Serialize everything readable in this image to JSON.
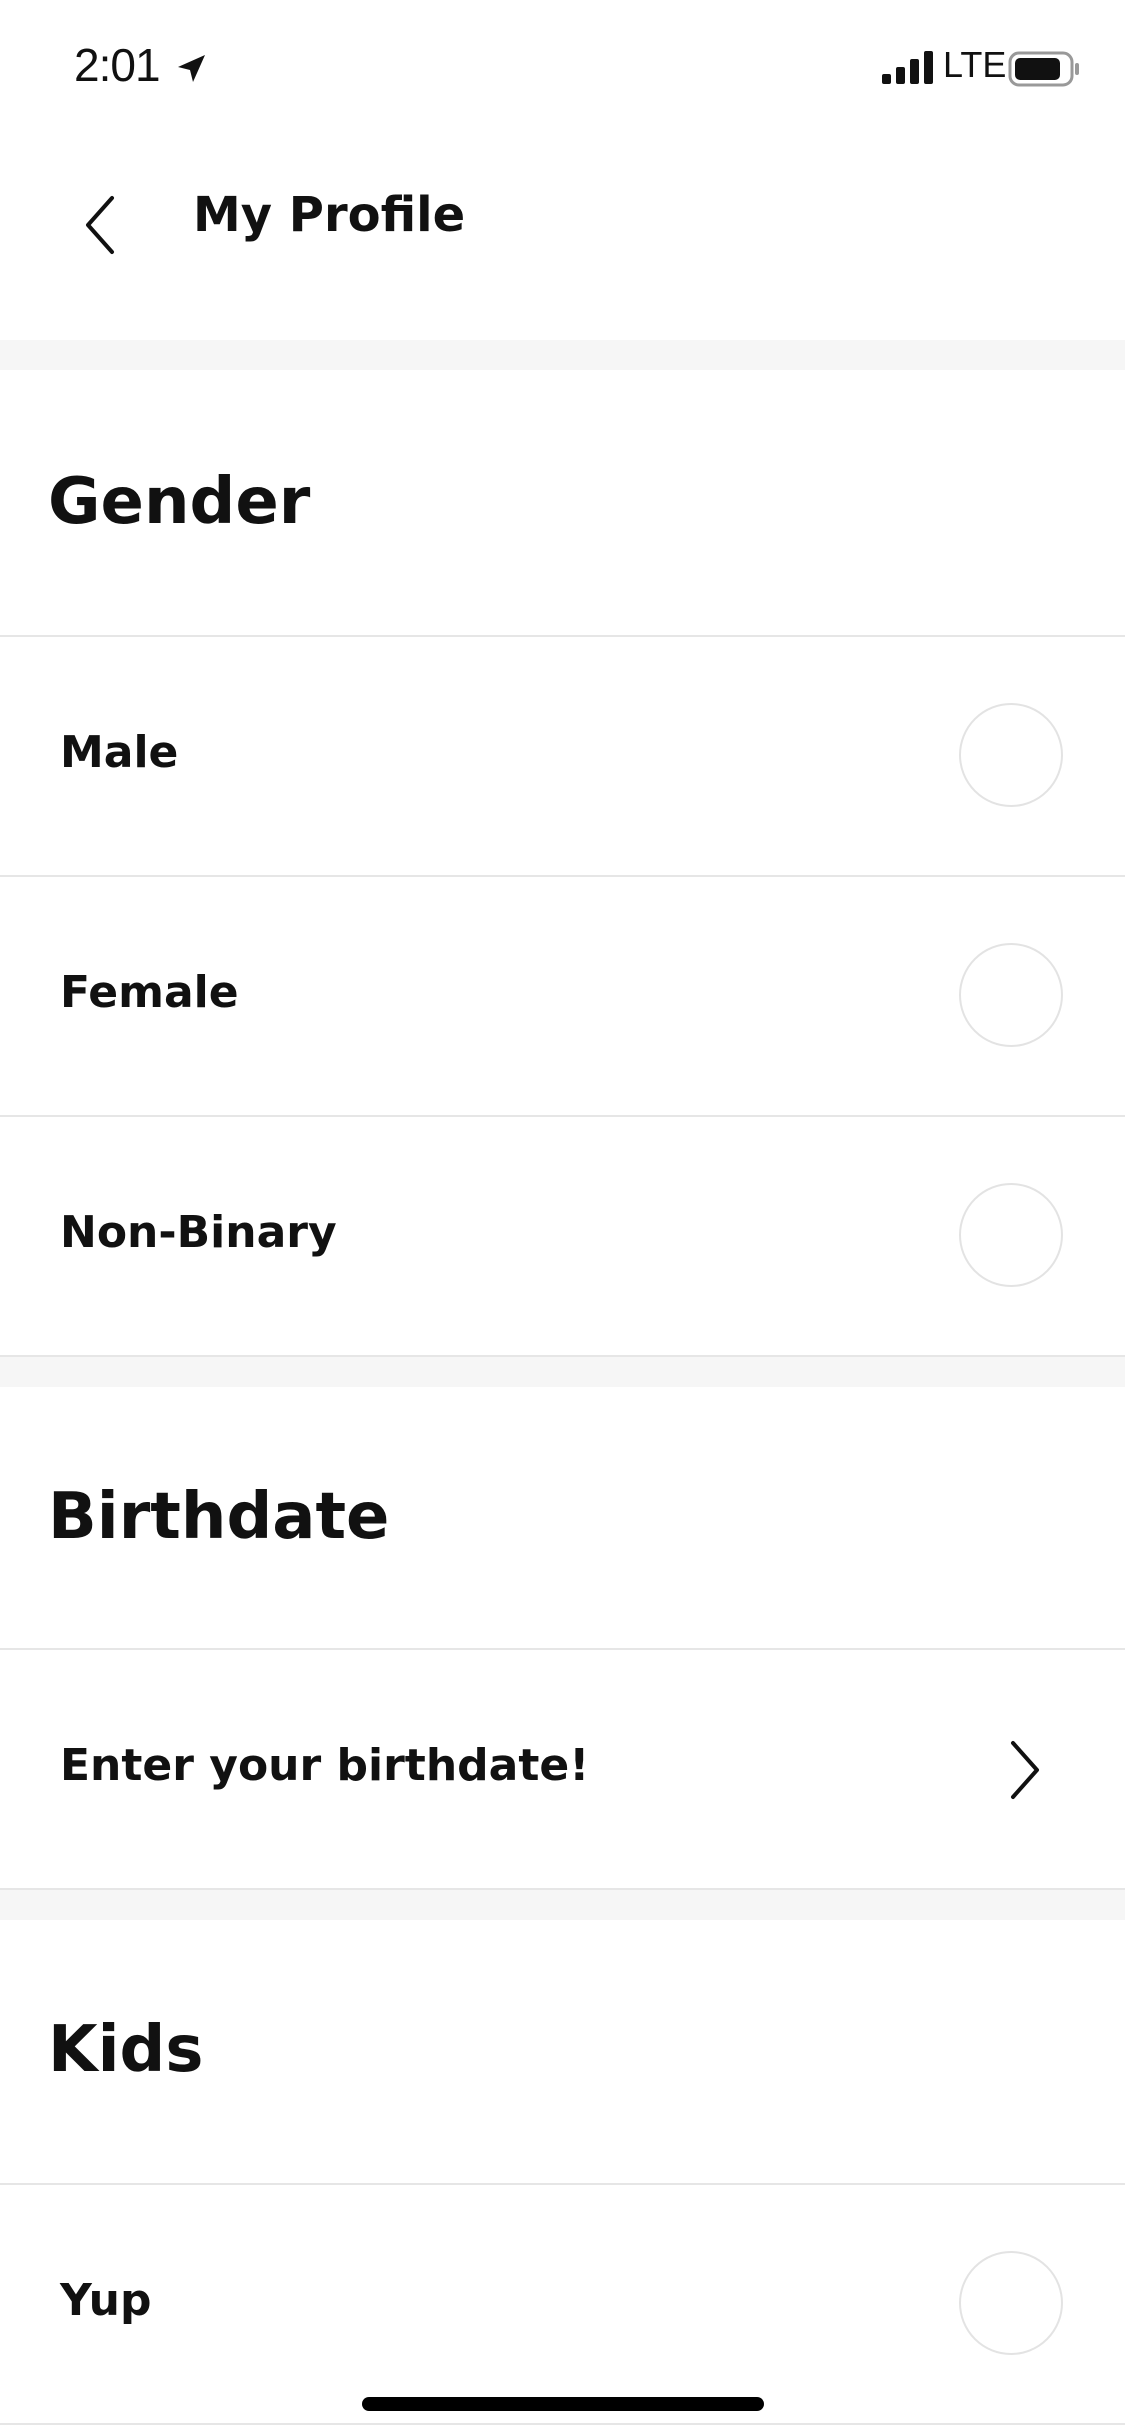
{
  "status_bar": {
    "time": "2:01",
    "network": "LTE",
    "icons": [
      "location-arrow-icon",
      "signal-icon",
      "battery-icon"
    ]
  },
  "header": {
    "title": "My Profile",
    "back_icon": "chevron-left-icon"
  },
  "sections": {
    "gender": {
      "heading": "Gender",
      "options": [
        {
          "label": "Male",
          "selected": false
        },
        {
          "label": "Female",
          "selected": false
        },
        {
          "label": "Non-Binary",
          "selected": false
        }
      ]
    },
    "birthdate": {
      "heading": "Birthdate",
      "row_label": "Enter your birthdate!",
      "row_icon": "chevron-right-icon"
    },
    "kids": {
      "heading": "Kids",
      "options": [
        {
          "label": "Yup",
          "selected": false
        }
      ]
    }
  },
  "colors": {
    "text": "#111111",
    "divider": "#e6e6e6",
    "band": "#f6f6f6",
    "radio_border": "#e3e3e3"
  }
}
